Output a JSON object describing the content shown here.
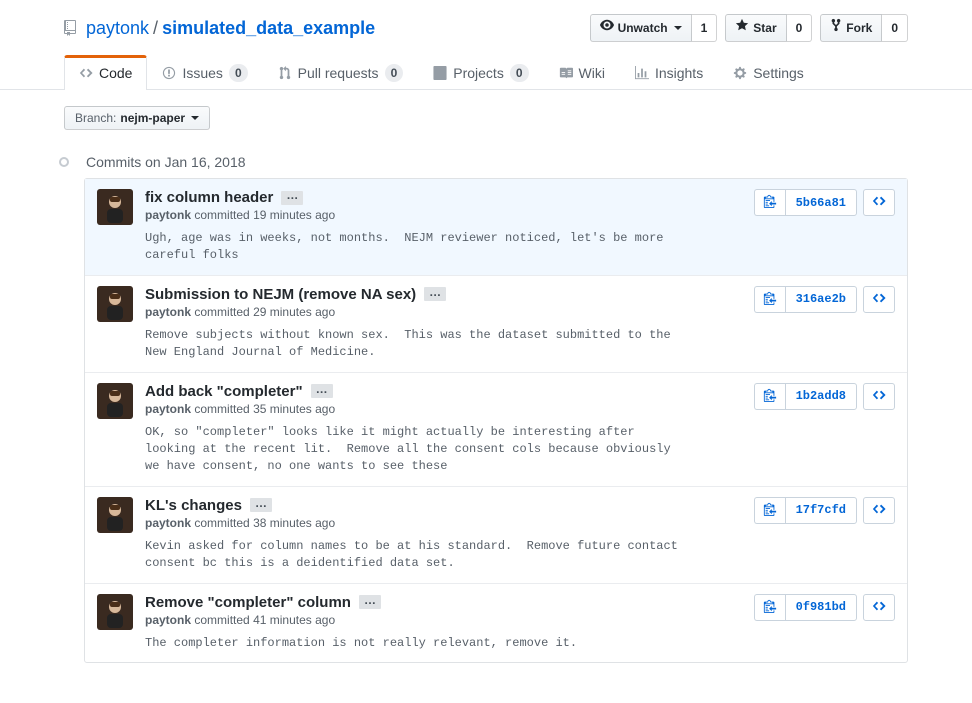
{
  "repo": {
    "owner": "paytonk",
    "name": "simulated_data_example"
  },
  "actions": {
    "watch_label": "Unwatch",
    "watch_count": "1",
    "star_label": "Star",
    "star_count": "0",
    "fork_label": "Fork",
    "fork_count": "0"
  },
  "nav": {
    "code": "Code",
    "issues": "Issues",
    "issues_count": "0",
    "pulls": "Pull requests",
    "pulls_count": "0",
    "projects": "Projects",
    "projects_count": "0",
    "wiki": "Wiki",
    "insights": "Insights",
    "settings": "Settings"
  },
  "branch_selector": {
    "prefix": "Branch: ",
    "current": "nejm-paper"
  },
  "commits_heading": "Commits on Jan 16, 2018",
  "commits": [
    {
      "title": "fix column header",
      "author": "paytonk",
      "committed_verb": "committed",
      "time": "19 minutes ago",
      "description": "Ugh, age was in weeks, not months.  NEJM reviewer noticed, let's be more\ncareful folks",
      "sha": "5b66a81"
    },
    {
      "title": "Submission to NEJM (remove NA sex)",
      "author": "paytonk",
      "committed_verb": "committed",
      "time": "29 minutes ago",
      "description": "Remove subjects without known sex.  This was the dataset submitted to the\nNew England Journal of Medicine.",
      "sha": "316ae2b"
    },
    {
      "title": "Add back \"completer\"",
      "author": "paytonk",
      "committed_verb": "committed",
      "time": "35 minutes ago",
      "description": "OK, so \"completer\" looks like it might actually be interesting after\nlooking at the recent lit.  Remove all the consent cols because obviously\nwe have consent, no one wants to see these",
      "sha": "1b2add8"
    },
    {
      "title": "KL's changes",
      "author": "paytonk",
      "committed_verb": "committed",
      "time": "38 minutes ago",
      "description": "Kevin asked for column names to be at his standard.  Remove future contact\nconsent bc this is a deidentified data set.",
      "sha": "17f7cfd"
    },
    {
      "title": "Remove \"completer\" column",
      "author": "paytonk",
      "committed_verb": "committed",
      "time": "41 minutes ago",
      "description": "The completer information is not really relevant, remove it.",
      "sha": "0f981bd"
    }
  ]
}
